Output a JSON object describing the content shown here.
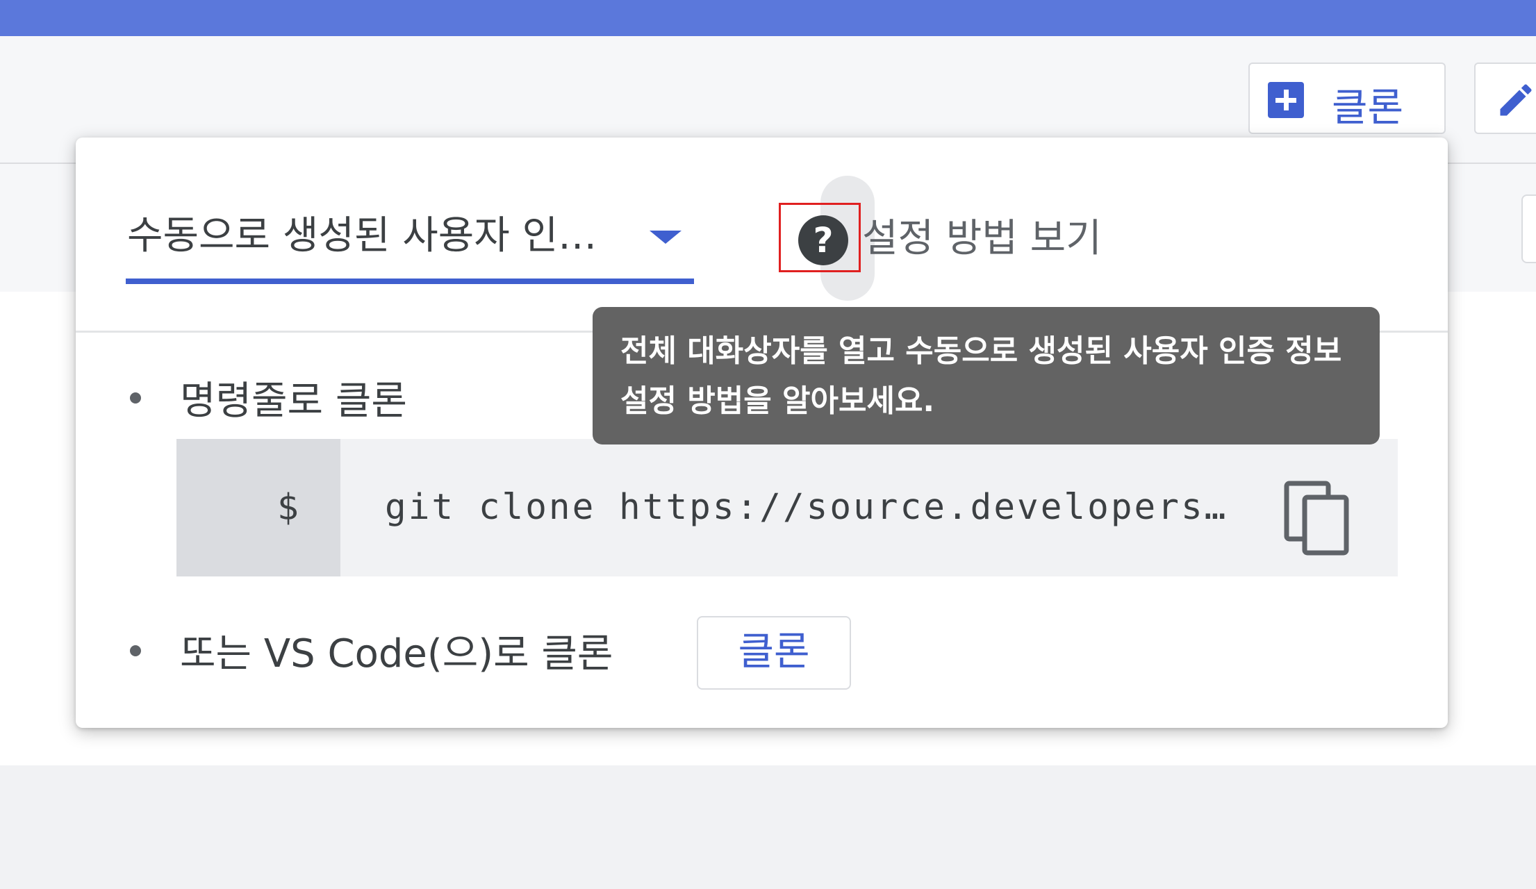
{
  "toolbar": {
    "clone_label": "클론",
    "edit_icon": "pencil-icon"
  },
  "popup": {
    "credential_select": {
      "value": "수동으로 생성된 사용자 인…"
    },
    "help": {
      "icon": "?",
      "label": "설정 방법 보기",
      "tooltip": "전체 대화상자를 열고 수동으로 생성된 사용자 인증 정보 설정 방법을 알아보세요."
    },
    "command_line": {
      "label": "명령줄로 클론",
      "prompt": "$",
      "command": "git clone https://source.developers…"
    },
    "vscode": {
      "label": "또는 VS Code(으)로 클론",
      "button": "클론"
    }
  },
  "colors": {
    "accent": "#3f5fcf",
    "topbar": "#5b78db",
    "tooltip_bg": "#636363",
    "highlight": "#e02020"
  }
}
